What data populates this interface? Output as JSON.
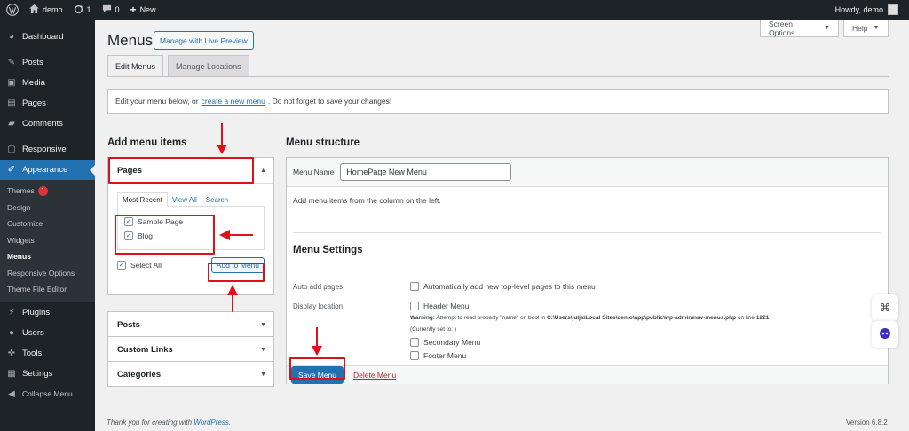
{
  "adminbar": {
    "site_name": "demo",
    "updates_count": "1",
    "comments_count": "0",
    "new_label": "New",
    "howdy": "Howdy, demo"
  },
  "sidebar": {
    "items": [
      {
        "label": "Dashboard",
        "icon": "dashboard-icon"
      },
      {
        "label": "Posts",
        "icon": "pin-icon"
      },
      {
        "label": "Media",
        "icon": "media-icon"
      },
      {
        "label": "Pages",
        "icon": "pages-icon"
      },
      {
        "label": "Comments",
        "icon": "comments-icon"
      },
      {
        "label": "Responsive",
        "icon": "responsive-icon"
      },
      {
        "label": "Appearance",
        "icon": "brush-icon"
      },
      {
        "label": "Plugins",
        "icon": "plugin-icon"
      },
      {
        "label": "Users",
        "icon": "users-icon"
      },
      {
        "label": "Tools",
        "icon": "wrench-icon"
      },
      {
        "label": "Settings",
        "icon": "settings-icon"
      },
      {
        "label": "Collapse Menu",
        "icon": "collapse-icon"
      }
    ],
    "submenu": [
      "Themes",
      "Design",
      "Customize",
      "Widgets",
      "Menus",
      "Responsive Options",
      "Theme File Editor"
    ],
    "themes_badge": "1"
  },
  "page": {
    "title": "Menus",
    "live_preview": "Manage with Live Preview",
    "screen_options": "Screen Options",
    "help": "Help",
    "tabs": [
      "Edit Menus",
      "Manage Locations"
    ],
    "notice_before": "Edit your menu below, or",
    "notice_link": "create a new menu",
    "notice_after": ". Do not forget to save your changes!"
  },
  "add_items": {
    "heading": "Add menu items",
    "pages_title": "Pages",
    "inner_tabs": [
      "Most Recent",
      "View All",
      "Search"
    ],
    "pages": [
      "Sample Page",
      "Blog"
    ],
    "select_all": "Select All",
    "add_button": "Add to Menu",
    "sections": [
      "Posts",
      "Custom Links",
      "Categories"
    ]
  },
  "structure": {
    "heading": "Menu structure",
    "name_label": "Menu Name",
    "name_value": "HomePage New Menu",
    "hint": "Add menu items from the column on the left.",
    "settings_title": "Menu Settings",
    "auto_add_label": "Auto add pages",
    "auto_add_option": "Automatically add new top-level pages to this menu",
    "display_location_label": "Display location",
    "locations": [
      "Header Menu",
      "Secondary Menu",
      "Footer Menu"
    ],
    "warning_label": "Warning:",
    "warning_text": "Attempt to read property \"name\" on bool in",
    "warning_path": "C:\\Users\\julja\\Local Sites\\demo\\app\\public\\wp-admin\\nav-menus.php",
    "warning_online": "on line",
    "warning_line": "1221",
    "currently_set": "(Currently set to: )",
    "save_button": "Save Menu",
    "delete_link": "Delete Menu"
  },
  "footer": {
    "thanks_prefix": "Thank you for creating with",
    "thanks_link": "WordPress",
    "thanks_suffix": ".",
    "version": "Version 6.8.2"
  },
  "colors": {
    "admin_dark": "#1d2327",
    "accent": "#2271b1",
    "annotation_red": "#e0101b"
  }
}
